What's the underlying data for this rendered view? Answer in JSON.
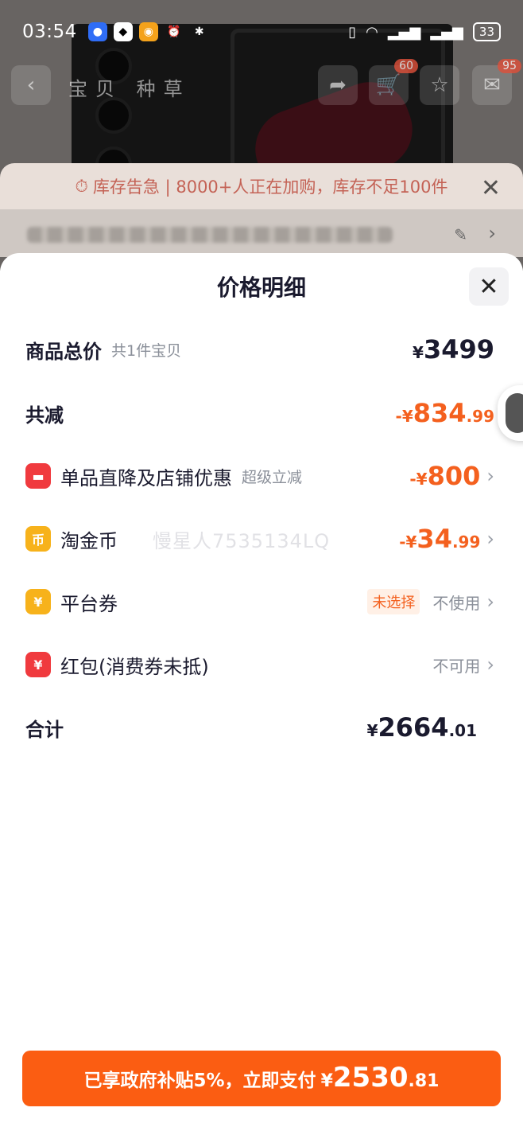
{
  "status_bar": {
    "time": "03:54",
    "battery": "33"
  },
  "background": {
    "nav_tabs": "宝贝 种草",
    "cart_badge": "60",
    "message_badge": "95",
    "alert_text": "库存告急 | 8000+人正在加购，库存不足100件"
  },
  "sheet": {
    "title": "价格明细",
    "total_row": {
      "label": "商品总价",
      "sub": "共1件宝贝",
      "symbol": "¥",
      "amount": "3499",
      "decimal": ""
    },
    "reduction_row": {
      "label": "共减",
      "prefix": "-¥",
      "amount": "834",
      "decimal": ".99"
    },
    "shop_discount": {
      "icon": "shop-discount-icon",
      "label": "单品直降及店铺优惠",
      "sub": "超级立减",
      "prefix": "-¥",
      "amount": "800",
      "decimal": ""
    },
    "taojin_coin": {
      "icon": "coin-icon",
      "icon_glyph": "币",
      "label": "淘金币",
      "prefix": "-¥",
      "amount": "34",
      "decimal": ".99"
    },
    "platform_coupon": {
      "icon": "coupon-icon",
      "icon_glyph": "¥",
      "label": "平台券",
      "tag": "未选择",
      "value": "不使用"
    },
    "red_packet": {
      "icon": "red-packet-icon",
      "icon_glyph": "¥",
      "label": "红包(消费券未抵)",
      "value": "不可用"
    },
    "sum_row": {
      "label": "合计",
      "symbol": "¥",
      "amount": "2664",
      "decimal": ".01"
    },
    "watermark": "慢星人7535134LQ"
  },
  "pay_button": {
    "text": "已享政府补贴5%，立即支付",
    "symbol": "¥",
    "amount": "2530",
    "decimal": ".81"
  },
  "colors": {
    "accent_orange": "#fb5d12",
    "discount_orange": "#f4601e",
    "text_dark": "#1a1a2e",
    "gray": "#8a8f99"
  }
}
